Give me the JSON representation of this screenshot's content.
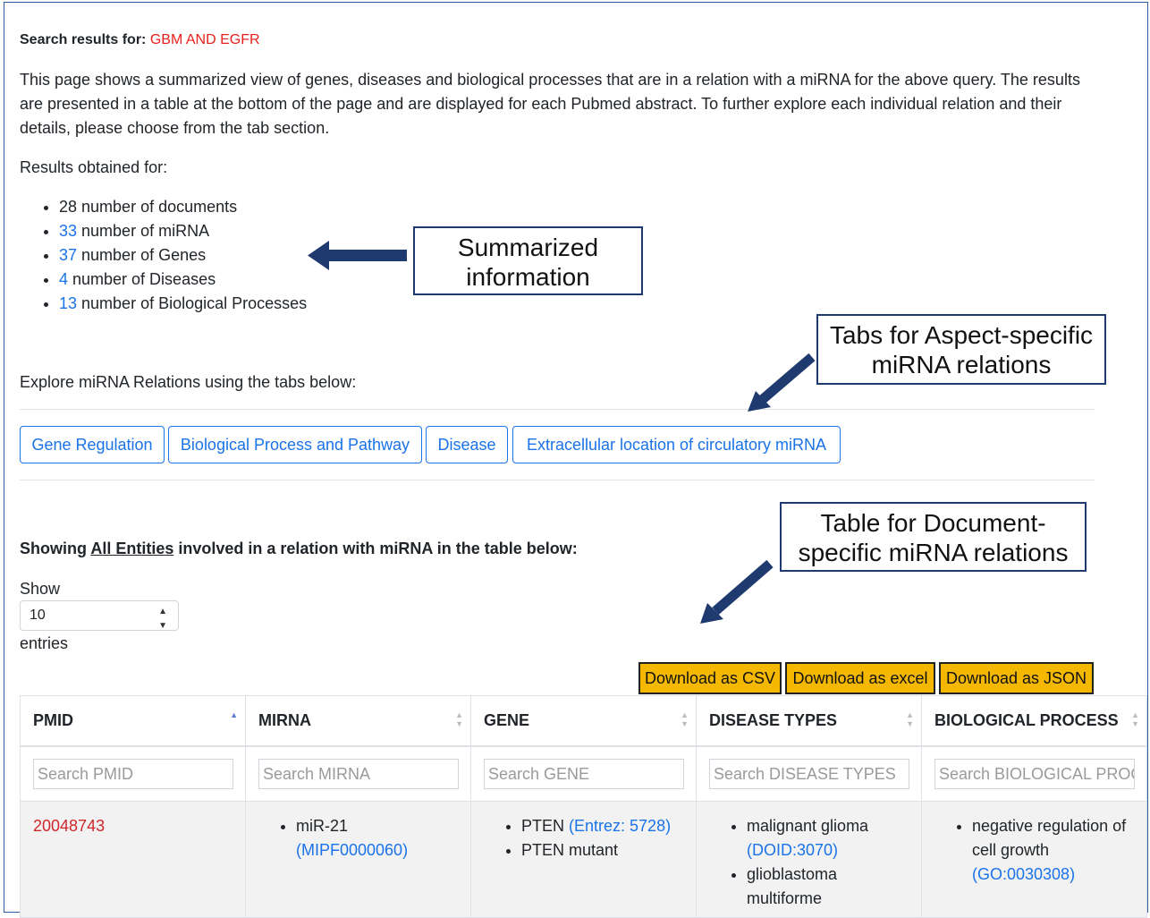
{
  "search": {
    "label": "Search results for:",
    "query": "GBM AND EGFR"
  },
  "intro": "This page shows a summarized view of genes, diseases and biological processes that are in a relation with a miRNA for the above query. The results are presented in a table at the bottom of the page and are displayed for each Pubmed abstract. To further explore each individual relation and their details, please choose from the tab section.",
  "results_label": "Results obtained for:",
  "counts": [
    {
      "num": "28",
      "text": " number of documents",
      "linked": false
    },
    {
      "num": "33",
      "text": " number of miRNA",
      "linked": true
    },
    {
      "num": "37",
      "text": " number of Genes",
      "linked": true
    },
    {
      "num": "4",
      "text": " number of Diseases",
      "linked": true
    },
    {
      "num": "13",
      "text": " number of Biological Processes",
      "linked": true
    }
  ],
  "explore_label": "Explore miRNA Relations using the tabs below:",
  "tabs": [
    "Gene Regulation",
    "Biological Process and Pathway",
    "Disease",
    "Extracellular location of circulatory miRNA"
  ],
  "showing": {
    "prefix": "Showing ",
    "link": "All Entities",
    "suffix": " involved in a relation with miRNA in the table below:"
  },
  "length_menu": {
    "show": "Show",
    "value": "10",
    "entries": "entries"
  },
  "downloads": [
    "Download as CSV",
    "Download as excel",
    "Download as JSON"
  ],
  "table": {
    "columns": [
      "PMID",
      "MIRNA",
      "GENE",
      "DISEASE TYPES",
      "BIOLOGICAL PROCESS"
    ],
    "search_placeholders": [
      "Search PMID",
      "Search MIRNA",
      "Search GENE",
      "Search DISEASE TYPES",
      "Search BIOLOGICAL PROC"
    ],
    "rows": [
      {
        "pmid": "20048743",
        "mirna": {
          "name": "miR-21",
          "id": "(MIPF0000060)"
        },
        "genes": [
          {
            "name": "PTEN ",
            "id": "(Entrez: 5728)"
          },
          {
            "name": "PTEN mutant",
            "id": ""
          }
        ],
        "diseases": [
          {
            "name": "malignant glioma",
            "id": "(DOID:3070)"
          },
          {
            "name": "glioblastoma multiforme",
            "id": ""
          }
        ],
        "process": {
          "name": "negative regulation of cell growth",
          "id": "(GO:0030308)"
        }
      }
    ]
  },
  "annotations": [
    "Summarized information",
    "Tabs for Aspect-specific miRNA relations",
    "Table for Document-specific miRNA relations"
  ],
  "colors": {
    "link": "#1a73e8",
    "query": "#e8201c",
    "pmid": "#d0262c",
    "download_bg": "#f5b800",
    "annotation_arrow": "#1f3a6e"
  }
}
